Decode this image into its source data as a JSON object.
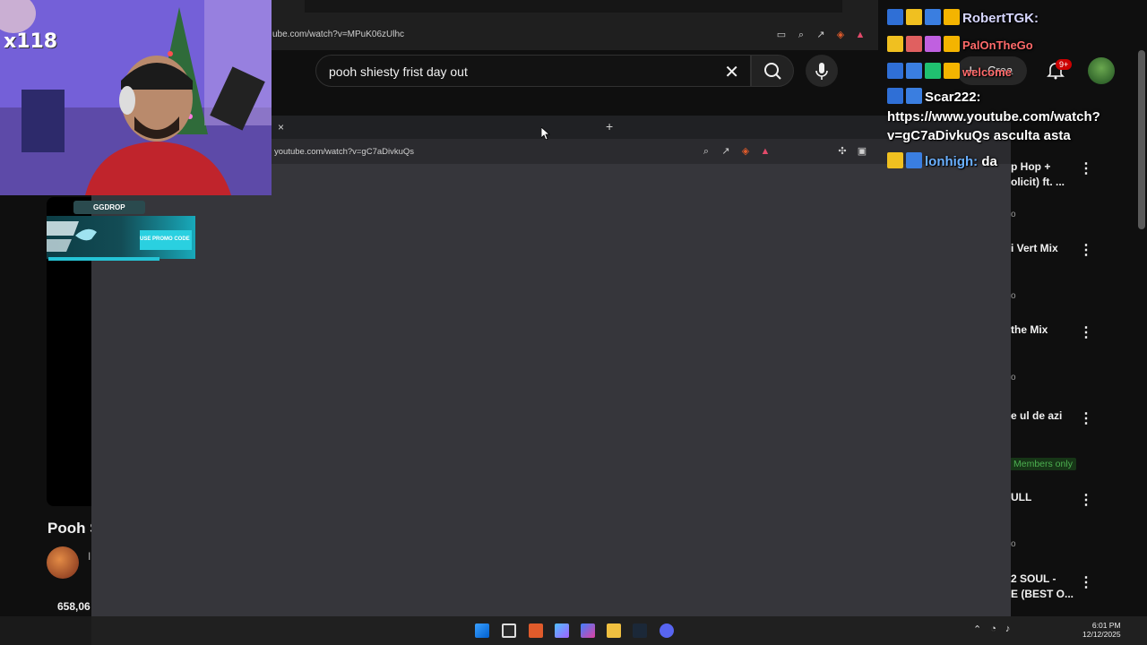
{
  "top_browser": {
    "url": "ube.com/watch?v=MPuK06zUlhc"
  },
  "youtube": {
    "search_value": "pooh shiesty frist day out",
    "create_label": "Crea",
    "notification_count": "9+",
    "video_title": "Pooh S",
    "channel_name": "I",
    "views": "658,06"
  },
  "recommendations": [
    {
      "title_line1": "p Hop +",
      "title_line2": "olicit) ft. ...",
      "meta": "o"
    },
    {
      "title_line1": "i Vert Mix",
      "title_line2": "",
      "meta": "o"
    },
    {
      "title_line1": "the Mix",
      "title_line2": "",
      "meta": "o"
    },
    {
      "title_line1": "e ul de azi",
      "title_line2": "",
      "meta": ""
    },
    {
      "title_line1": "ULL",
      "title_line2": "",
      "meta": "o"
    },
    {
      "title_line1": "2 SOUL -",
      "title_line2": "E (BEST O...",
      "meta": ""
    }
  ],
  "members_only_label": "Members only",
  "new_window": {
    "url": "youtube.com/watch?v=gC7aDivkuQs",
    "tab_close": "×",
    "new_tab": "+"
  },
  "webcam": {
    "multiplier": "x118"
  },
  "ggdrop": {
    "label": "GGDROP",
    "promo": "USE PROMO CODE"
  },
  "chat": [
    {
      "user": "RobertTGK:",
      "message": ""
    },
    {
      "user": "PalOnTheGo",
      "message": ""
    },
    {
      "user": "",
      "message": "welcome"
    },
    {
      "user": "Scar222:",
      "message": ""
    },
    {
      "user": "",
      "message": "https://www.youtube.com/watch?"
    },
    {
      "user": "",
      "message": "v=gC7aDivkuQs asculta asta"
    },
    {
      "user": "lonhigh:",
      "message": "da"
    }
  ],
  "taskbar": {
    "time": "6:01 PM",
    "date": "12/12/2025"
  },
  "colors": {
    "youtube_bg": "#0f0f0f",
    "window_gray": "#36363b",
    "members_green": "#4caf50",
    "notification_red": "#cc0000"
  }
}
